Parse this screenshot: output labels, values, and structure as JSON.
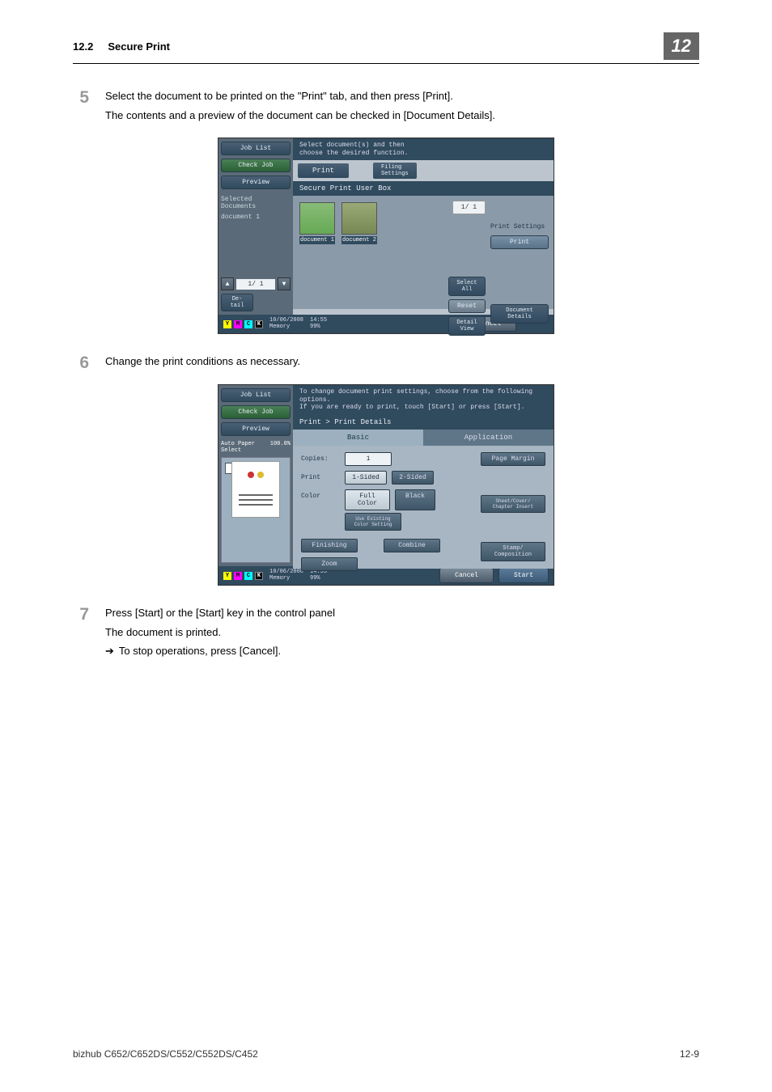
{
  "header": {
    "section_num": "12.2",
    "section_title": "Secure Print",
    "chapter_num": "12"
  },
  "steps": {
    "s5": {
      "num": "5",
      "line1": "Select the document to be printed on the \"Print\" tab, and then press [Print].",
      "line2": "The contents and a preview of the document can be checked in [Document Details]."
    },
    "s6": {
      "num": "6",
      "line1": "Change the print conditions as necessary."
    },
    "s7": {
      "num": "7",
      "line1": "Press [Start] or the [Start] key in the control panel",
      "line2": "The document is printed.",
      "line3": "To stop operations, press [Cancel]."
    }
  },
  "shot1": {
    "msg": "Select document(s) and then\nchoose the desired function.",
    "left": {
      "job_list": "Job List",
      "check_job": "Check Job",
      "preview": "Preview",
      "selected": "Selected Documents",
      "doc1": "document 1",
      "page_ind": "1/  1",
      "detail_btn": "De-\ntail"
    },
    "tabs": {
      "print": "Print",
      "filing": "Filing\nSettings"
    },
    "sub_bar": "Secure Print User Box",
    "thumbs": {
      "d1": "document 1",
      "d2": "document 2"
    },
    "right": {
      "page": "1/  1",
      "print_settings": "Print Settings",
      "print": "Print",
      "select_all": "Select\nAll",
      "reset": "Reset",
      "detail_view": "Detail\nView",
      "doc_details": "Document\nDetails"
    },
    "footer": {
      "date": "10/06/2008",
      "time": "14:55",
      "mem_lbl": "Memory",
      "mem_val": "99%",
      "cancel": "Cancel"
    },
    "toner": {
      "y": "Y",
      "m": "M",
      "c": "C",
      "k": "K"
    }
  },
  "shot2": {
    "msg": "To change document print settings, choose from the following\noptions.\nIf you are ready to print, touch [Start] or press [Start].",
    "left": {
      "job_list": "Job List",
      "check_job": "Check Job",
      "preview": "Preview",
      "auto": "Auto Paper\nSelect",
      "zoom": "100.0%"
    },
    "breadcrumb": "Print > Print Details",
    "tabs": {
      "basic": "Basic",
      "application": "Application"
    },
    "form": {
      "copies_lbl": "Copies:",
      "copies_val": "1",
      "print_lbl": "Print",
      "one_sided": "1-Sided",
      "two_sided": "2-Sided",
      "color_lbl": "Color",
      "full_color": "Full Color",
      "black": "Black",
      "use_existing": "Use Existing\nColor Setting",
      "finishing": "Finishing",
      "combine": "Combine",
      "zoom": "Zoom"
    },
    "right": {
      "page_margin": "Page Margin",
      "sheet": "Sheet/Cover/\nChapter Insert",
      "stamp": "Stamp/\nComposition"
    },
    "footer": {
      "date": "10/06/2008",
      "time": "14:55",
      "mem_lbl": "Memory",
      "mem_val": "99%",
      "cancel": "Cancel",
      "start": "Start"
    }
  },
  "page_footer": {
    "left": "bizhub C652/C652DS/C552/C552DS/C452",
    "right": "12-9"
  }
}
